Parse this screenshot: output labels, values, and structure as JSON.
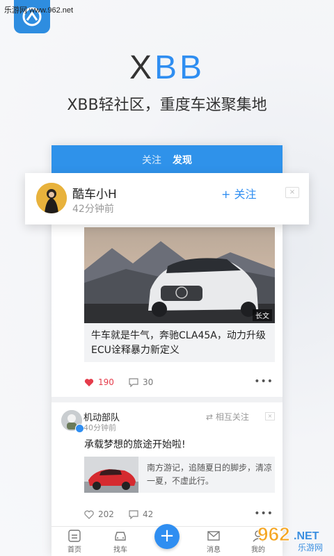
{
  "watermark_top": "乐游网 www.962.net",
  "brand": {
    "x": "X",
    "bb": "BB"
  },
  "tagline": "XBB轻社区，重度车迷聚集地",
  "top_tabs": [
    {
      "label": "关注"
    },
    {
      "label": "发现"
    }
  ],
  "suggest_card": {
    "name": "酷车小H",
    "time": "42分钟前",
    "follow_label": "+ 关注",
    "close_label": "×"
  },
  "post1": {
    "badge": "长文",
    "title": "牛车就是牛气，奔驰CLA45A，动力升级ECU诠释暴力新定义",
    "likes": "190",
    "comments": "30",
    "more": "•••"
  },
  "post2": {
    "name": "机动部队",
    "time": "40分钟前",
    "mutual_label": "⇄ 相互关注",
    "close_label": "×",
    "text": "承载梦想的旅途开始啦!",
    "link_text": "南方游记，追随夏日的脚步，清凉一夏，不虚此行。",
    "likes": "202",
    "comments": "42",
    "more": "•••"
  },
  "tabbar": {
    "items": [
      {
        "label": "首页"
      },
      {
        "label": "找车"
      },
      {
        "label": "消息"
      },
      {
        "label": "我的"
      }
    ],
    "fab": "+"
  },
  "watermark_bottom": {
    "big": "962",
    "net": ".NET",
    "sub": "乐游网"
  },
  "colors": {
    "accent": "#2f8ef1",
    "like_red": "#e53c4b",
    "header_blue": "#2f92ea"
  }
}
